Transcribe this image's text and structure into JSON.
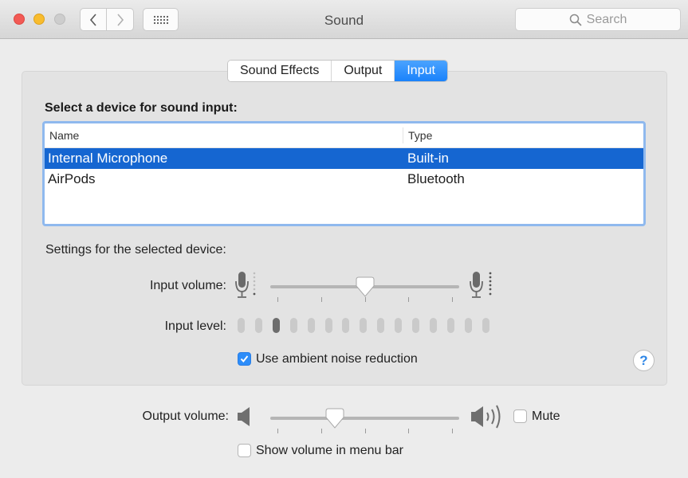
{
  "window": {
    "title": "Sound",
    "search_placeholder": "Search",
    "nav": {
      "back": "‹",
      "forward": "›"
    }
  },
  "tabs": [
    {
      "label": "Sound Effects",
      "active": false
    },
    {
      "label": "Output",
      "active": false
    },
    {
      "label": "Input",
      "active": true
    }
  ],
  "input": {
    "section_title": "Select a device for sound input:",
    "columns": {
      "name": "Name",
      "type": "Type"
    },
    "devices": [
      {
        "name": "Internal Microphone",
        "type": "Built-in",
        "selected": true
      },
      {
        "name": "AirPods",
        "type": "Bluetooth",
        "selected": false
      }
    ],
    "settings_label": "Settings for the selected device:",
    "input_volume_label": "Input volume:",
    "input_volume": 0.5,
    "input_level_label": "Input level:",
    "input_level_segments": 15,
    "input_level_active_index": 2,
    "noise_reduction_label": "Use ambient noise reduction",
    "noise_reduction_checked": true,
    "help": "?"
  },
  "output": {
    "volume_label": "Output volume:",
    "volume": 0.33,
    "mute_label": "Mute",
    "mute_checked": false,
    "show_in_menu_bar_label": "Show volume in menu bar",
    "show_in_menu_bar_checked": false
  },
  "colors": {
    "accent": "#1a82fb",
    "selection": "#1566d1",
    "focus_ring": "#8fb9ee"
  }
}
